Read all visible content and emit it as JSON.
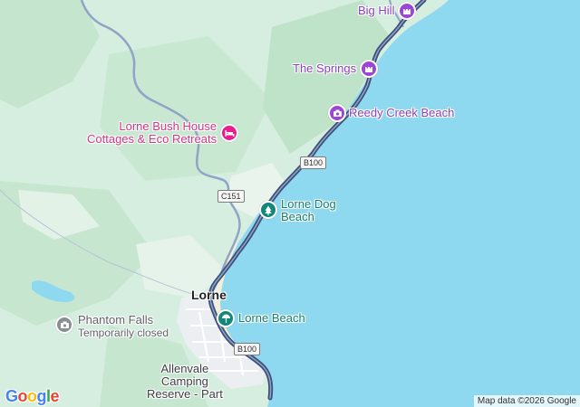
{
  "map": {
    "places": {
      "big_hill": "Big Hill",
      "the_springs": "The Springs",
      "reedy_creek": "Reedy Creek Beach",
      "bush_house_line1": "Lorne Bush House",
      "bush_house_line2": "Cottages & Eco Retreats",
      "dog_beach_line1": "Lorne Dog",
      "dog_beach_line2": "Beach",
      "lorne": "Lorne",
      "lorne_beach": "Lorne Beach",
      "phantom_falls": "Phantom Falls",
      "phantom_falls_status": "Temporarily closed",
      "allenvale_line1": "Allenvale",
      "allenvale_line2": "Camping",
      "allenvale_line3": "Reserve - Part"
    },
    "road_shields": {
      "b100_north": "B100",
      "c151": "C151",
      "b100_south": "B100"
    },
    "logo": "Google",
    "attribution": "Map data ©2026 Google",
    "colors": {
      "water": "#8fd9f0",
      "land": "#d6eedf",
      "park": "#c6e6cf",
      "route": "#3d4f7a",
      "road": "#8fa4c6",
      "urban": "#eceff1",
      "pink_poi": "#e91e8c",
      "purple_poi": "#9c45d6",
      "teal_poi": "#12877a",
      "gray_poi": "#8a8f94"
    },
    "icons": [
      "castle-icon",
      "camera-icon",
      "hotel-icon",
      "tree-icon",
      "umbrella-icon"
    ]
  }
}
